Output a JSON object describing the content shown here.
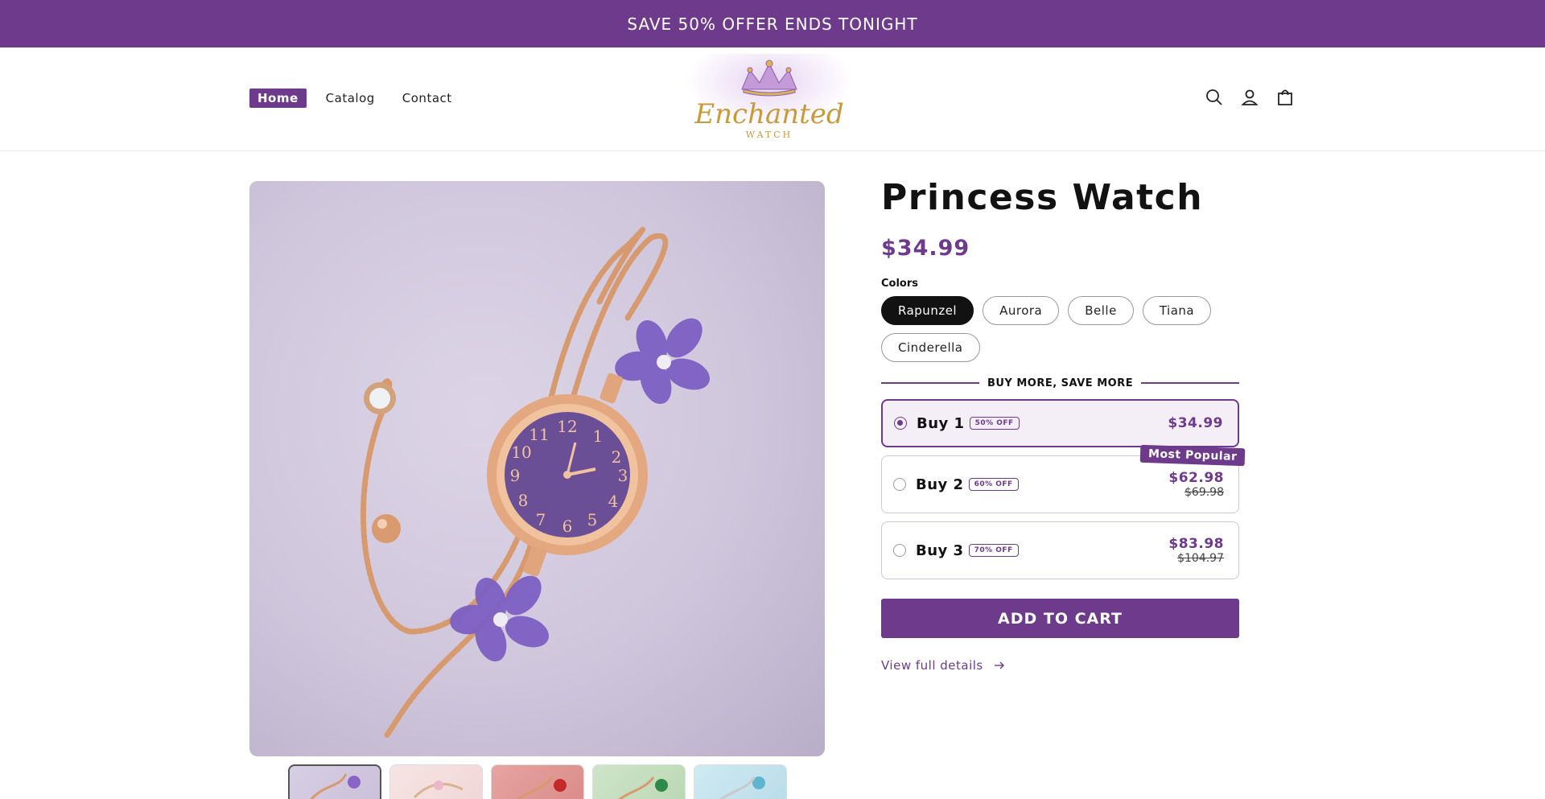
{
  "announcement": {
    "text": "SAVE 50% OFFER ENDS TONIGHT"
  },
  "nav": {
    "items": [
      {
        "label": "Home"
      },
      {
        "label": "Catalog"
      },
      {
        "label": "Contact"
      }
    ]
  },
  "logo": {
    "wordmark": "Enchanted",
    "subtitle": "WATCH"
  },
  "header_icons": [
    "search-icon",
    "account-icon",
    "cart-icon"
  ],
  "product": {
    "title": "Princess Watch",
    "price": "$34.99",
    "colors_label": "Colors",
    "colors": [
      {
        "label": "Rapunzel",
        "selected": true
      },
      {
        "label": "Aurora"
      },
      {
        "label": "Belle"
      },
      {
        "label": "Tiana"
      },
      {
        "label": "Cinderella"
      }
    ]
  },
  "bundles": {
    "heading": "BUY MORE, SAVE MORE",
    "items": [
      {
        "label": "Buy 1",
        "badge": "50% OFF",
        "price": "$34.99",
        "old_price": "",
        "selected": true
      },
      {
        "label": "Buy 2",
        "badge": "60% OFF",
        "price": "$62.98",
        "old_price": "$69.98",
        "tag": "Most Popular"
      },
      {
        "label": "Buy 3",
        "badge": "70% OFF",
        "price": "$83.98",
        "old_price": "$104.97"
      }
    ]
  },
  "actions": {
    "add_to_cart": "ADD TO CART",
    "view_details": "View full details"
  },
  "colors": {
    "accent": "#6e3a8c",
    "text": "#121212"
  }
}
